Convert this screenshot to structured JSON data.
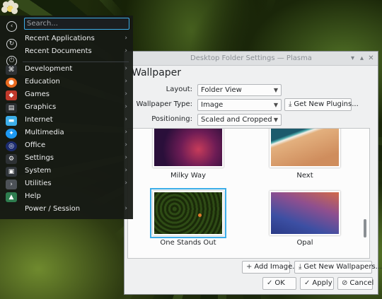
{
  "dialog": {
    "title": "Desktop Folder Settings — Plasma",
    "heading": "Wallpaper",
    "layout": {
      "label": "Layout:",
      "value": "Folder View"
    },
    "wallpaper_type": {
      "label": "Wallpaper Type:",
      "value": "Image"
    },
    "positioning": {
      "label": "Positioning:",
      "value": "Scaled and Cropped"
    },
    "get_new_plugins": "Get New Plugins...",
    "wallpapers": [
      {
        "name": "Milky Way"
      },
      {
        "name": "Next"
      },
      {
        "name": "One Stands Out",
        "selected": true
      },
      {
        "name": "Opal"
      }
    ],
    "add_image": "Add Image...",
    "get_new_wallpapers": "Get New Wallpapers...",
    "ok": "OK",
    "apply": "Apply",
    "cancel": "Cancel"
  },
  "launcher": {
    "search_placeholder": "Search...",
    "items": [
      {
        "label": "Recent Applications",
        "icon": "clock-icon"
      },
      {
        "label": "Recent Documents",
        "icon": "document-icon"
      },
      {
        "label": "Development",
        "icon": "code-icon"
      },
      {
        "label": "Education",
        "icon": "firefox-icon"
      },
      {
        "label": "Games",
        "icon": "games-icon"
      },
      {
        "label": "Graphics",
        "icon": "graphics-icon"
      },
      {
        "label": "Internet",
        "icon": "internet-icon"
      },
      {
        "label": "Multimedia",
        "icon": "multimedia-icon"
      },
      {
        "label": "Office",
        "icon": "office-icon"
      },
      {
        "label": "Settings",
        "icon": "settings-icon"
      },
      {
        "label": "System",
        "icon": "system-icon"
      },
      {
        "label": "Utilities",
        "icon": "utilities-icon"
      },
      {
        "label": "Help",
        "icon": "help-icon"
      },
      {
        "label": "Power / Session",
        "icon": "power-icon"
      }
    ]
  },
  "colors": {
    "accent": "#3daee9",
    "panel": "#161a14",
    "dialog_bg": "#eff0f1"
  }
}
